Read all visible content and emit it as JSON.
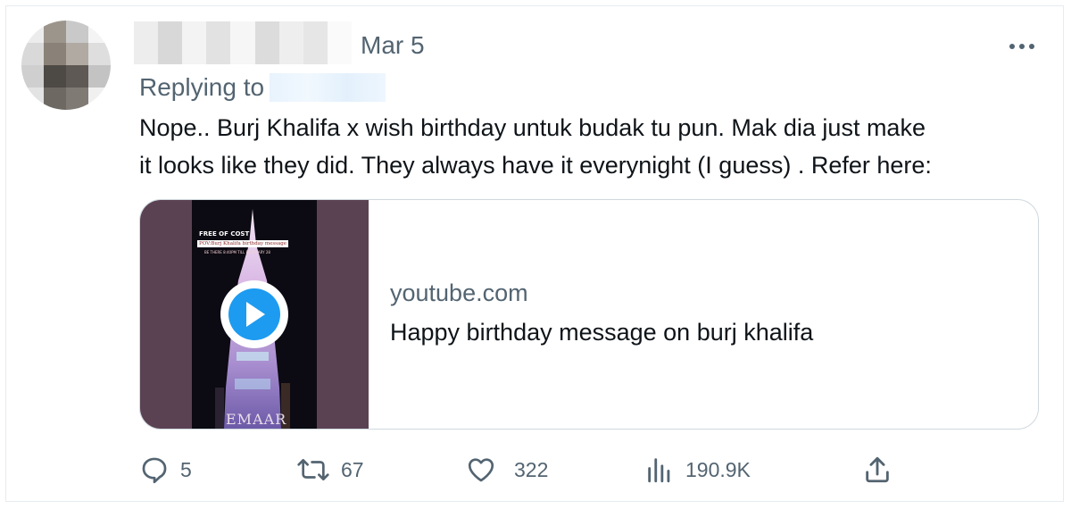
{
  "tweet": {
    "date": "Mar 5",
    "replying_label": "Replying to",
    "text_lines": [
      "Nope.. Burj Khalifa x wish birthday untuk budak tu pun. Mak dia just make",
      "it looks like they did. They always have it everynight (I guess) . Refer here:"
    ]
  },
  "card": {
    "domain": "youtube.com",
    "title": "Happy birthday message on burj khalifa",
    "thumbnail": {
      "caption_top": "FREE OF COST",
      "caption_mid": "POV:Burj Khalifa birthday message",
      "caption_small": "BE THERE 8:40PM TILL FEBRUARY 28",
      "brand": "EMAAR"
    }
  },
  "actions": {
    "replies": "5",
    "retweets": "67",
    "likes": "322",
    "views": "190.9K"
  },
  "icons": {
    "more": "more-horizontal-icon",
    "reply": "reply-icon",
    "retweet": "retweet-icon",
    "like": "heart-icon",
    "views": "views-bar-chart-icon",
    "share": "share-icon",
    "play": "play-icon"
  },
  "colors": {
    "accent": "#1d9bf0",
    "secondary_text": "#536471",
    "primary_text": "#0f1419",
    "border": "#cfd9de"
  }
}
